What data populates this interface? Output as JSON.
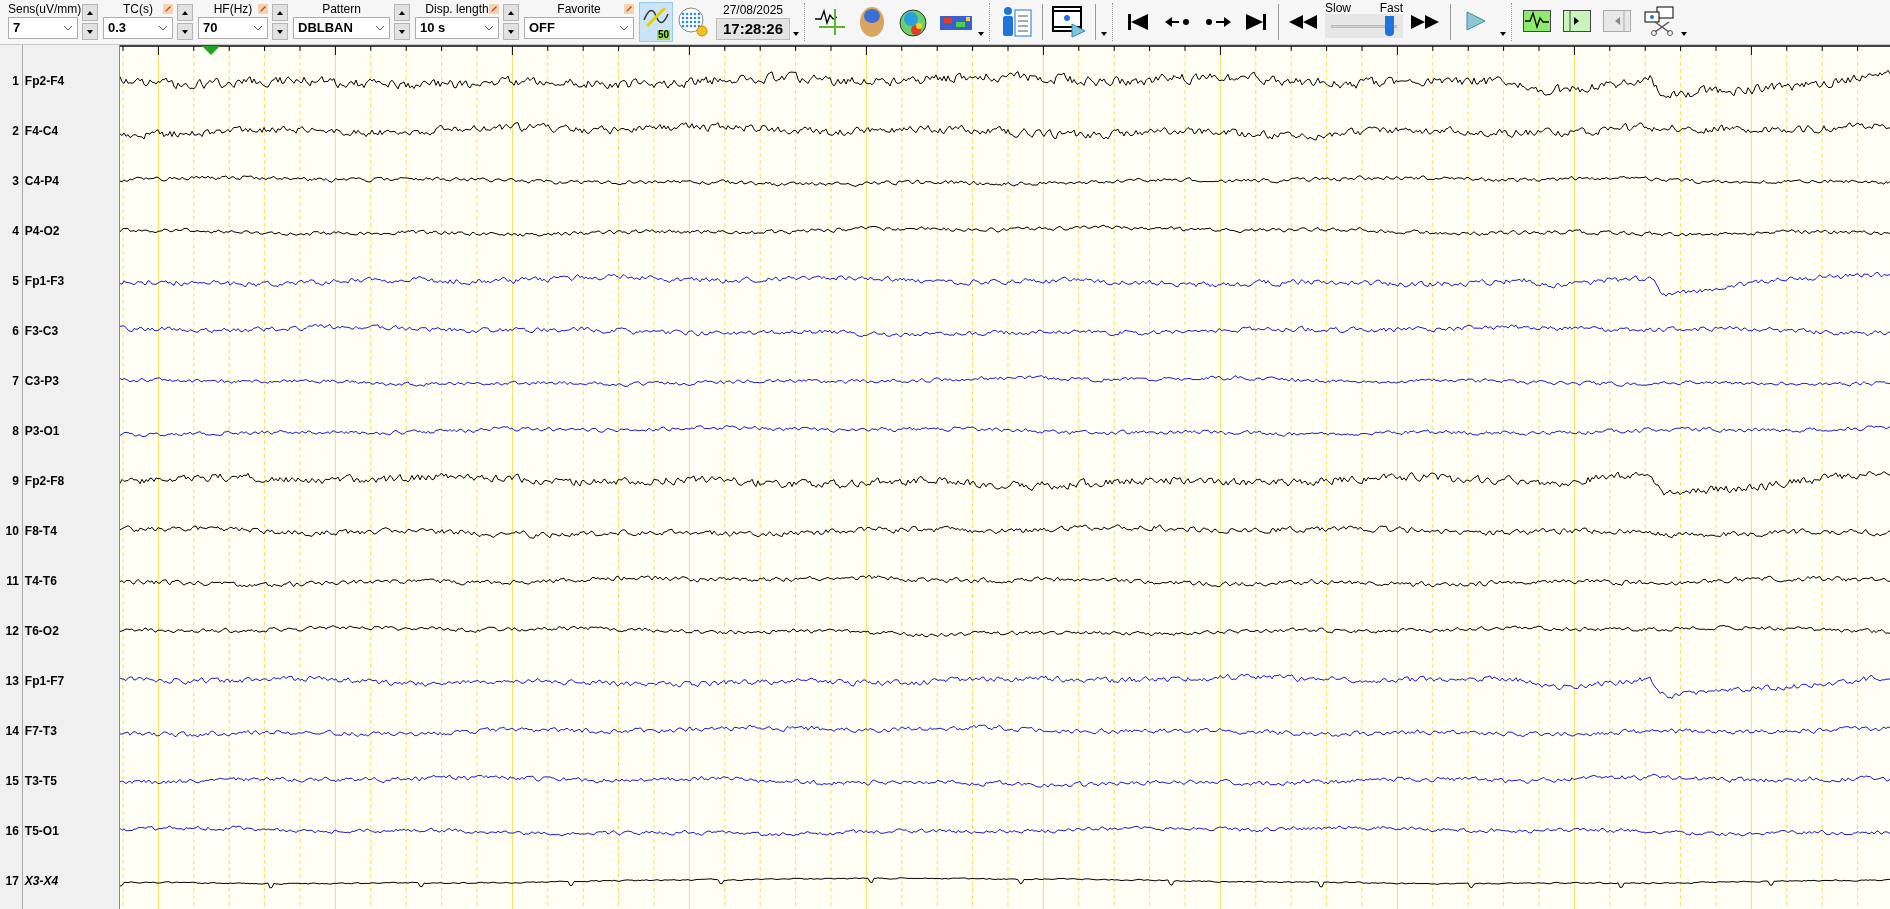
{
  "toolbar": {
    "controls": [
      {
        "label": "Sens(uV/mm)",
        "value": "7",
        "edit_icon": false,
        "spinner": true
      },
      {
        "label": "TC(s)",
        "value": "0.3",
        "edit_icon": true,
        "spinner": true
      },
      {
        "label": "HF(Hz)",
        "value": "70",
        "edit_icon": true,
        "spinner": true
      },
      {
        "label": "Pattern",
        "value": "DBLBAN",
        "edit_icon": false,
        "spinner": true
      },
      {
        "label": "Disp. length",
        "value": "10 s",
        "edit_icon": true,
        "spinner": true
      },
      {
        "label": "Favorite",
        "value": "OFF",
        "edit_icon": true,
        "spinner": false
      }
    ],
    "notch": {
      "label": "50",
      "selected": true
    },
    "date": "27/08/2025",
    "time": "17:28:26",
    "speed": {
      "slow_label": "Slow",
      "fast_label": "Fast",
      "level": 0.9
    }
  },
  "channels": [
    {
      "number": "1",
      "name": "Fp2-F4",
      "color": "#000000",
      "kind": "eeg"
    },
    {
      "number": "2",
      "name": "F4-C4",
      "color": "#000000",
      "kind": "eeg"
    },
    {
      "number": "3",
      "name": "C4-P4",
      "color": "#000000",
      "kind": "eeg"
    },
    {
      "number": "4",
      "name": "P4-O2",
      "color": "#000000",
      "kind": "eeg"
    },
    {
      "number": "5",
      "name": "Fp1-F3",
      "color": "#1c1cc8",
      "kind": "eeg"
    },
    {
      "number": "6",
      "name": "F3-C3",
      "color": "#1c1cc8",
      "kind": "eeg"
    },
    {
      "number": "7",
      "name": "C3-P3",
      "color": "#1c1cc8",
      "kind": "eeg"
    },
    {
      "number": "8",
      "name": "P3-O1",
      "color": "#1c1cc8",
      "kind": "eeg"
    },
    {
      "number": "9",
      "name": "Fp2-F8",
      "color": "#000000",
      "kind": "eeg"
    },
    {
      "number": "10",
      "name": "F8-T4",
      "color": "#000000",
      "kind": "eeg"
    },
    {
      "number": "11",
      "name": "T4-T6",
      "color": "#000000",
      "kind": "eeg"
    },
    {
      "number": "12",
      "name": "T6-O2",
      "color": "#000000",
      "kind": "eeg"
    },
    {
      "number": "13",
      "name": "Fp1-F7",
      "color": "#1c1cc8",
      "kind": "eeg"
    },
    {
      "number": "14",
      "name": "F7-T3",
      "color": "#1c1cc8",
      "kind": "eeg"
    },
    {
      "number": "15",
      "name": "T3-T5",
      "color": "#1c1cc8",
      "kind": "eeg"
    },
    {
      "number": "16",
      "name": "T5-O1",
      "color": "#1c1cc8",
      "kind": "eeg"
    },
    {
      "number": "17",
      "name": "X3-X4",
      "color": "#000000",
      "kind": "aux"
    }
  ]
}
